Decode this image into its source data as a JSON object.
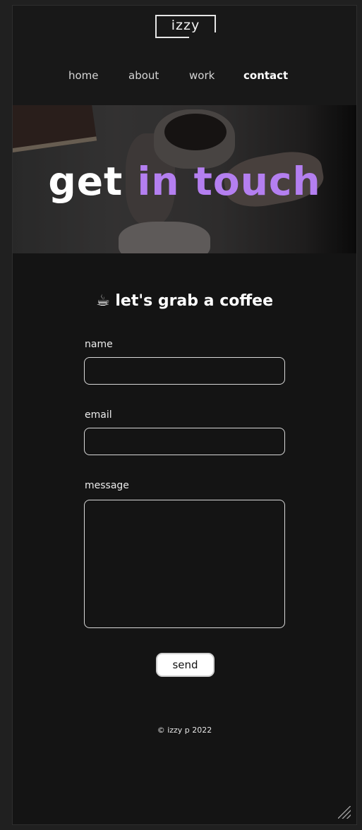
{
  "header": {
    "logo_text": "izzy",
    "nav": [
      {
        "label": "home",
        "active": false
      },
      {
        "label": "about",
        "active": false
      },
      {
        "label": "work",
        "active": false
      },
      {
        "label": "contact",
        "active": true
      }
    ]
  },
  "hero": {
    "title_part1": "get",
    "title_part2": "in touch",
    "accent_color": "#b47ff0"
  },
  "contact": {
    "subtitle": "☕ let's grab a coffee",
    "fields": [
      {
        "label": "name",
        "value": ""
      },
      {
        "label": "email",
        "value": ""
      },
      {
        "label": "message",
        "value": ""
      }
    ],
    "send_label": "send"
  },
  "footer": {
    "text": "© izzy p 2022"
  }
}
